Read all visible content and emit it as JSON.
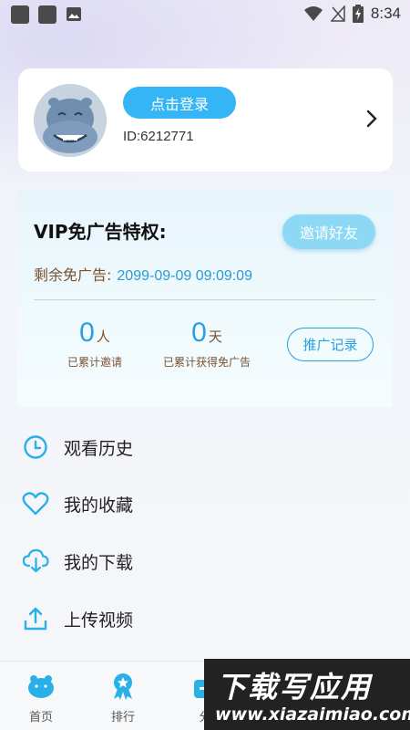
{
  "status_bar": {
    "time": "8:34",
    "icons": [
      "app-icon",
      "app-icon",
      "image-icon",
      "wifi-icon",
      "no-signal-icon",
      "battery-charging-icon"
    ]
  },
  "profile": {
    "login_label": "点击登录",
    "user_id": "ID:6212771",
    "avatar": "hippo-avatar"
  },
  "vip": {
    "title": "VIP免广告特权:",
    "invite_label": "邀请好友",
    "remain_label": "剩余免广告:",
    "remain_value": "2099-09-09 09:09:09",
    "invited_count": "0",
    "invited_unit": "人",
    "invited_caption": "已累计邀请",
    "days_count": "0",
    "days_unit": "天",
    "days_caption": "已累计获得免广告",
    "promo_label": "推广记录"
  },
  "menu": [
    {
      "label": "观看历史",
      "icon": "clock-icon"
    },
    {
      "label": "我的收藏",
      "icon": "heart-icon"
    },
    {
      "label": "我的下载",
      "icon": "cloud-download-icon"
    },
    {
      "label": "上传视频",
      "icon": "upload-icon"
    }
  ],
  "bottom_nav": [
    {
      "label": "首页",
      "icon": "hippo-home-icon"
    },
    {
      "label": "排行",
      "icon": "ribbon-star-icon"
    },
    {
      "label": "分",
      "icon": "category-icon"
    }
  ],
  "watermark": {
    "title": "下载写应用",
    "url": "www.xiazaimiao.com"
  },
  "colors": {
    "accent": "#35b5f5",
    "accent_light": "#8dd8f4",
    "text_brown": "#7a5230",
    "link_blue": "#2a9fe0"
  }
}
